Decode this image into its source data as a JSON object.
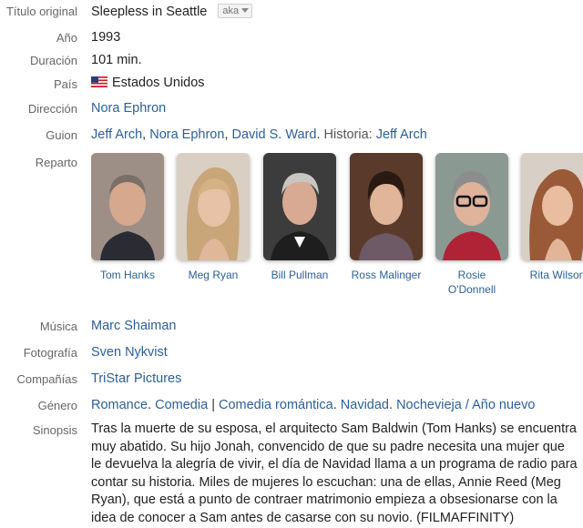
{
  "labels": {
    "original_title": "Título original",
    "year": "Año",
    "duration": "Duración",
    "country": "País",
    "director": "Dirección",
    "script": "Guion",
    "cast": "Reparto",
    "music": "Música",
    "photography": "Fotografía",
    "companies": "Compañías",
    "genre": "Género",
    "synopsis": "Sinopsis"
  },
  "movie": {
    "original_title": "Sleepless in Seattle",
    "aka_label": "aka",
    "year": "1993",
    "duration": "101 min.",
    "country": "Estados Unidos",
    "country_flag_icon": "us-flag-icon",
    "director": "Nora Ephron",
    "script": {
      "writers": [
        "Jeff Arch",
        "Nora Ephron",
        "David S. Ward"
      ],
      "story_label": "Historia:",
      "story": "Jeff Arch"
    },
    "cast": [
      {
        "name": "Tom Hanks",
        "photo_color": "#8a6a58"
      },
      {
        "name": "Meg Ryan",
        "photo_color": "#c9a57a"
      },
      {
        "name": "Bill Pullman",
        "photo_color": "#4b4b4b"
      },
      {
        "name": "Ross Malinger",
        "photo_color": "#5a3a28"
      },
      {
        "name": "Rosie O'Donnell",
        "photo_color": "#7d8f88"
      },
      {
        "name": "Rita Wilson",
        "photo_color": "#c07a5a"
      }
    ],
    "music": "Marc Shaiman",
    "photography": "Sven Nykvist",
    "companies": "TriStar Pictures",
    "genre": {
      "primary": [
        "Romance",
        "Comedia"
      ],
      "secondary": [
        "Comedia romántica",
        "Navidad",
        "Nochevieja / Año nuevo"
      ]
    },
    "synopsis": "Tras la muerte de su esposa, el arquitecto Sam Baldwin (Tom Hanks) se encuentra muy abatido. Su hijo Jonah, convencido de que su padre necesita una mujer que le devuelva la alegría de vivir, el día de Navidad llama a un programa de radio para contar su historia. Miles de mujeres lo escuchan: una de ellas, Annie Reed (Meg Ryan), que está a punto de contraer matrimonio empieza a obsesionarse con la idea de conocer a Sam antes de casarse con su novio. (FILMAFFINITY)"
  }
}
